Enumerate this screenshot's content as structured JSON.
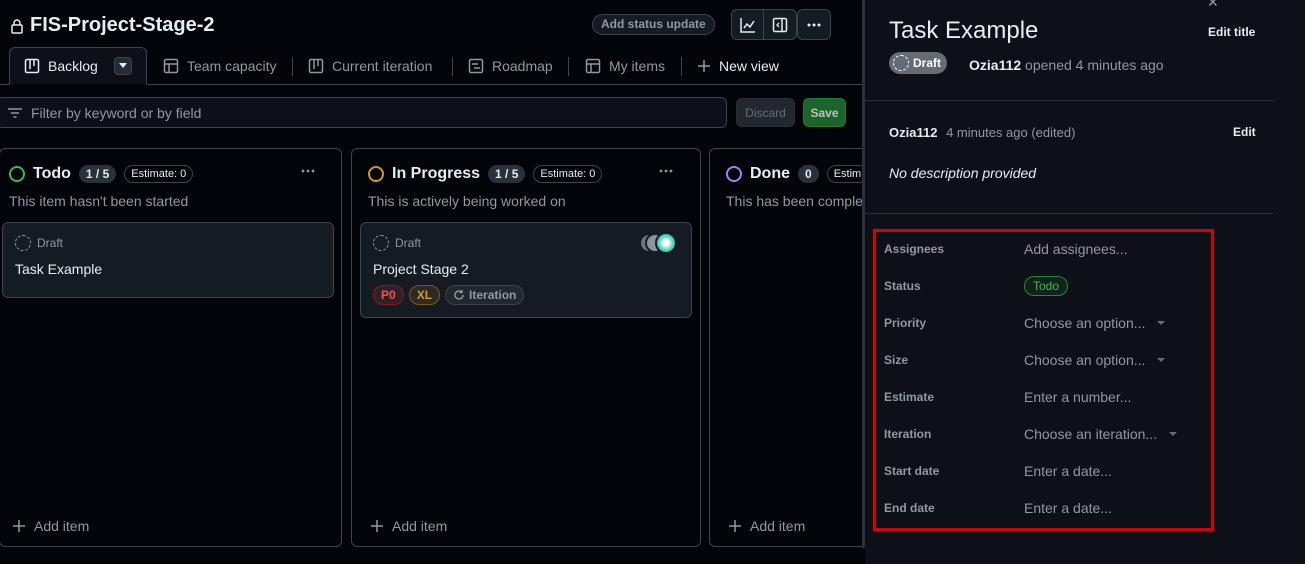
{
  "project": {
    "title": "FIS-Project-Stage-2",
    "status_update_label": "Add status update"
  },
  "tabs": [
    {
      "label": "Backlog"
    },
    {
      "label": "Team capacity"
    },
    {
      "label": "Current iteration"
    },
    {
      "label": "Roadmap"
    },
    {
      "label": "My items"
    },
    {
      "label": "New view"
    }
  ],
  "filter": {
    "placeholder": "Filter by keyword or by field",
    "discard_label": "Discard",
    "save_label": "Save"
  },
  "columns": [
    {
      "name": "Todo",
      "count": "1 / 5",
      "estimate": "Estimate: 0",
      "description": "This item hasn't been started",
      "add_label": "Add item",
      "color": "#3fb950"
    },
    {
      "name": "In Progress",
      "count": "1 / 5",
      "estimate": "Estimate: 0",
      "description": "This is actively being worked on",
      "add_label": "Add item",
      "color": "#d29922"
    },
    {
      "name": "Done",
      "count": "0",
      "estimate": "Estim",
      "description": "This has been complet",
      "add_label": "Add item",
      "color": "#ab7df8"
    }
  ],
  "cards": {
    "todo": {
      "type": "Draft",
      "title": "Task Example"
    },
    "in_progress": {
      "type": "Draft",
      "title": "Project Stage 2",
      "labels": [
        {
          "text": "P0",
          "color": "#f85149"
        },
        {
          "text": "XL",
          "color": "#d29922"
        },
        {
          "text": "Iteration",
          "color": "#9198a1"
        }
      ]
    }
  },
  "panel": {
    "title": "Task Example",
    "edit_title_label": "Edit title",
    "badge": "Draft",
    "author": "Ozia112",
    "opened_text": "opened 4 minutes ago",
    "comment": {
      "author": "Ozia112",
      "meta": "4 minutes ago (edited)",
      "edit_label": "Edit",
      "body": "No description provided"
    },
    "fields": [
      {
        "label": "Assignees",
        "value": "Add assignees..."
      },
      {
        "label": "Status",
        "value": "Todo"
      },
      {
        "label": "Priority",
        "value": "Choose an option..."
      },
      {
        "label": "Size",
        "value": "Choose an option..."
      },
      {
        "label": "Estimate",
        "value": "Enter a number..."
      },
      {
        "label": "Iteration",
        "value": "Choose an iteration..."
      },
      {
        "label": "Start date",
        "value": "Enter a date..."
      },
      {
        "label": "End date",
        "value": "Enter a date..."
      }
    ]
  },
  "colors": {
    "background": "#010409",
    "panel": "#0d1117",
    "border": "#3d444d",
    "highlight_box": "#d00010",
    "save_green": "#238636"
  }
}
